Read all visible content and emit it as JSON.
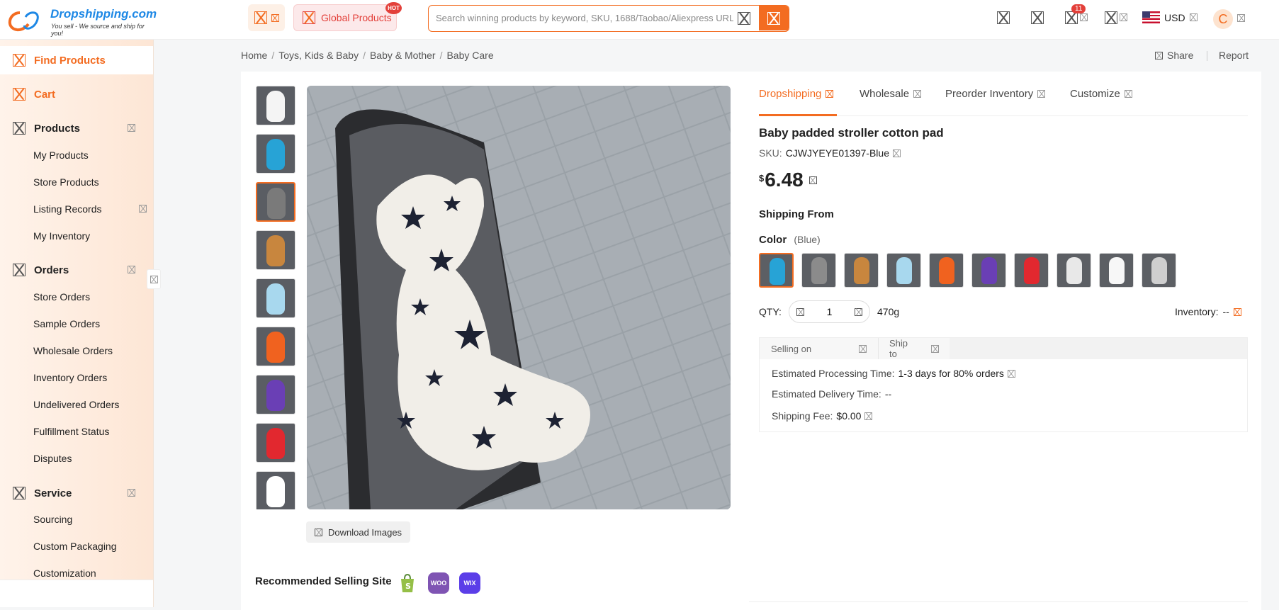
{
  "header": {
    "logo_name": "Dropshipping.com",
    "logo_tagline": "You sell - We source and ship for you!",
    "global_products": "Global Products",
    "hot_badge": "HOT",
    "search_placeholder": "Search winning products by keyword, SKU, 1688/Taobao/Aliexpress URL",
    "cart_count": "11",
    "currency": "USD",
    "avatar_letter": "C"
  },
  "sidebar": {
    "find_products": "Find Products",
    "cart": "Cart",
    "products": "Products",
    "products_items": [
      "My Products",
      "Store Products",
      "Listing Records",
      "My Inventory"
    ],
    "orders": "Orders",
    "orders_items": [
      "Store Orders",
      "Sample Orders",
      "Wholesale Orders",
      "Inventory Orders",
      "Undelivered Orders",
      "Fulfillment Status",
      "Disputes"
    ],
    "service": "Service",
    "service_items": [
      "Sourcing",
      "Custom Packaging",
      "Customization"
    ]
  },
  "breadcrumb": [
    "Home",
    "Toys, Kids & Baby",
    "Baby & Mother",
    "Baby Care"
  ],
  "actions": {
    "share": "Share",
    "report": "Report"
  },
  "gallery": {
    "download_images": "Download Images",
    "thumb_colors": [
      "#f4f4f4",
      "#27a3d6",
      "#7a7a7a",
      "#c8863e",
      "#a8d8ee",
      "#f0621f",
      "#6a3fb5",
      "#e2282f",
      "#ffffff"
    ]
  },
  "recommended": {
    "label": "Recommended Selling Site",
    "sites": [
      {
        "name": "Shopify",
        "color": "#95bf47",
        "icon": "shopify-icon"
      },
      {
        "name": "WOO",
        "color": "#7f54b3",
        "icon": "woocommerce-icon"
      },
      {
        "name": "WIX",
        "color": "#5b3ee8",
        "icon": "wix-icon"
      }
    ]
  },
  "product": {
    "tabs": [
      "Dropshipping",
      "Wholesale",
      "Preorder Inventory",
      "Customize"
    ],
    "title": "Baby padded stroller cotton pad",
    "sku_label": "SKU:",
    "sku": "CJWJYEYE01397-Blue",
    "currency_symbol": "$",
    "price": "6.48",
    "shipping_from": "Shipping From",
    "color_label": "Color",
    "color_selected": "(Blue)",
    "swatches": [
      {
        "name": "Blue",
        "color": "#27a3d6"
      },
      {
        "name": "Grey",
        "color": "#8b8b8b"
      },
      {
        "name": "Brown",
        "color": "#c8863e"
      },
      {
        "name": "Light Blue",
        "color": "#a8d8ee"
      },
      {
        "name": "Orange",
        "color": "#f0621f"
      },
      {
        "name": "Purple",
        "color": "#6a3fb5"
      },
      {
        "name": "Red",
        "color": "#e2282f"
      },
      {
        "name": "White Star",
        "color": "#e8e8e8"
      },
      {
        "name": "White",
        "color": "#f7f7f7"
      },
      {
        "name": "Plaid",
        "color": "#cfcfcf"
      }
    ],
    "qty_label": "QTY:",
    "qty_value": "1",
    "weight": "470g",
    "inventory_label": "Inventory:",
    "inventory_value": "--"
  },
  "shipping": {
    "selling_on": "Selling on",
    "ship_to": "Ship to",
    "processing_label": "Estimated Processing Time:",
    "processing_value": "1-3 days for 80% orders",
    "delivery_label": "Estimated Delivery Time:",
    "delivery_value": "--",
    "fee_label": "Shipping Fee:",
    "fee_value": "$0.00"
  }
}
